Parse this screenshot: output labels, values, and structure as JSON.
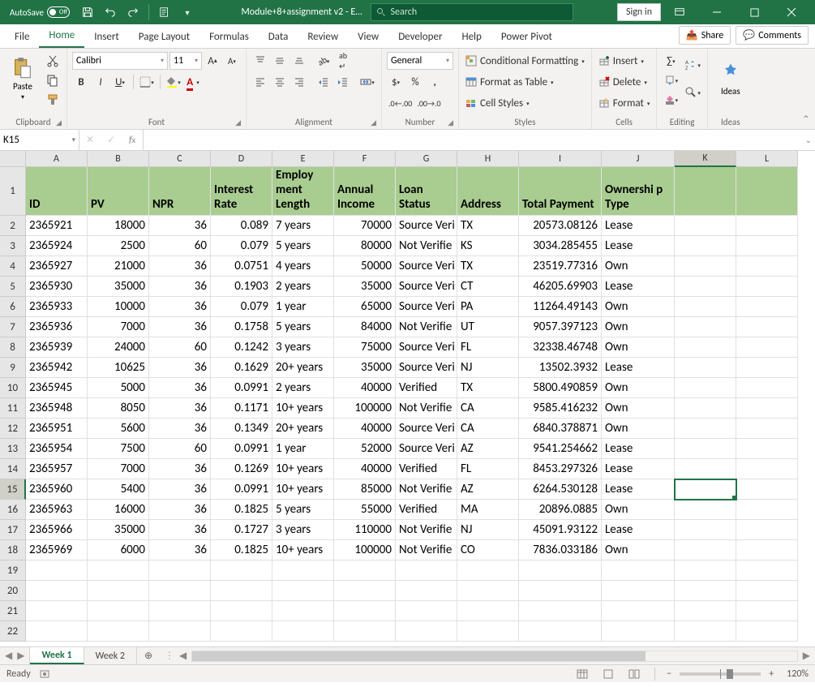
{
  "titlebar": {
    "autosave_label": "AutoSave",
    "doc_title": "Module+8+assignment v2 - E…",
    "search_placeholder": "Search",
    "signin": "Sign in"
  },
  "tabs": {
    "file": "File",
    "home": "Home",
    "insert": "Insert",
    "page_layout": "Page Layout",
    "formulas": "Formulas",
    "data": "Data",
    "review": "Review",
    "view": "View",
    "developer": "Developer",
    "help": "Help",
    "power_pivot": "Power Pivot",
    "share": "Share",
    "comments": "Comments"
  },
  "ribbon": {
    "clipboard": {
      "label": "Clipboard",
      "paste": "Paste"
    },
    "font": {
      "label": "Font",
      "name": "Calibri",
      "size": "11"
    },
    "alignment": {
      "label": "Alignment"
    },
    "number": {
      "label": "Number",
      "format": "General"
    },
    "styles": {
      "label": "Styles",
      "cond_fmt": "Conditional Formatting",
      "table": "Format as Table",
      "cell_styles": "Cell Styles"
    },
    "cells": {
      "label": "Cells",
      "insert": "Insert",
      "delete": "Delete",
      "format": "Format"
    },
    "editing": {
      "label": "Editing"
    },
    "ideas": {
      "label": "Ideas",
      "btn": "Ideas"
    }
  },
  "name_box": "K15",
  "columns": [
    "A",
    "B",
    "C",
    "D",
    "E",
    "F",
    "G",
    "H",
    "I",
    "J",
    "K",
    "L"
  ],
  "headers": [
    "ID",
    "PV",
    "NPR",
    "Interest Rate",
    "Employ ment Length",
    "Annual Income",
    "Loan Status",
    "Address",
    "Total Payment",
    "Ownershi p Type",
    "",
    ""
  ],
  "chart_data": {
    "type": "table",
    "columns": [
      "ID",
      "PV",
      "NPR",
      "Interest Rate",
      "Employment Length",
      "Annual Income",
      "Loan Status",
      "Address",
      "Total Payment",
      "Ownership Type"
    ],
    "rows": [
      [
        2365921,
        18000,
        36,
        0.089,
        "7 years",
        70000,
        "Source Veri",
        "TX",
        20573.08126,
        "Lease"
      ],
      [
        2365924,
        2500,
        60,
        0.079,
        "5 years",
        80000,
        "Not Verified",
        "KS",
        3034.285455,
        "Lease"
      ],
      [
        2365927,
        21000,
        36,
        0.0751,
        "4 years",
        50000,
        "Source Veri",
        "TX",
        23519.77316,
        "Own"
      ],
      [
        2365930,
        35000,
        36,
        0.1903,
        "2 years",
        35000,
        "Source Veri",
        "CT",
        46205.69903,
        "Lease"
      ],
      [
        2365933,
        10000,
        36,
        0.079,
        "1 year",
        65000,
        "Source Veri",
        "PA",
        11264.49143,
        "Own"
      ],
      [
        2365936,
        7000,
        36,
        0.1758,
        "5 years",
        84000,
        "Not Verified",
        "UT",
        9057.397123,
        "Own"
      ],
      [
        2365939,
        24000,
        60,
        0.1242,
        "3 years",
        75000,
        "Source Veri",
        "FL",
        32338.46748,
        "Own"
      ],
      [
        2365942,
        10625,
        36,
        0.1629,
        "20+ years",
        35000,
        "Source Veri",
        "NJ",
        13502.3932,
        "Lease"
      ],
      [
        2365945,
        5000,
        36,
        0.0991,
        "2 years",
        40000,
        "Verified",
        "TX",
        5800.490859,
        "Own"
      ],
      [
        2365948,
        8050,
        36,
        0.1171,
        "10+ years",
        100000,
        "Not Verified",
        "CA",
        9585.416232,
        "Own"
      ],
      [
        2365951,
        5600,
        36,
        0.1349,
        "20+ years",
        40000,
        "Source Veri",
        "CA",
        6840.378871,
        "Own"
      ],
      [
        2365954,
        7500,
        60,
        0.0991,
        "1 year",
        52000,
        "Source Veri",
        "AZ",
        9541.254662,
        "Lease"
      ],
      [
        2365957,
        7000,
        36,
        0.1269,
        "10+ years",
        40000,
        "Verified",
        "FL",
        8453.297326,
        "Lease"
      ],
      [
        2365960,
        5400,
        36,
        0.0991,
        "10+ years",
        85000,
        "Not Verified",
        "AZ",
        6264.530128,
        "Lease"
      ],
      [
        2365963,
        16000,
        36,
        0.1825,
        "5 years",
        55000,
        "Verified",
        "MA",
        20896.0885,
        "Own"
      ],
      [
        2365966,
        35000,
        36,
        0.1727,
        "3 years",
        110000,
        "Not Verified",
        "NJ",
        45091.93122,
        "Lease"
      ],
      [
        2365969,
        6000,
        36,
        0.1825,
        "10+ years",
        100000,
        "Not Verified",
        "CO",
        7836.033186,
        "Own"
      ]
    ]
  },
  "sheets": {
    "active": "Week 1",
    "other": "Week 2"
  },
  "status": {
    "ready": "Ready",
    "zoom": "120%"
  }
}
